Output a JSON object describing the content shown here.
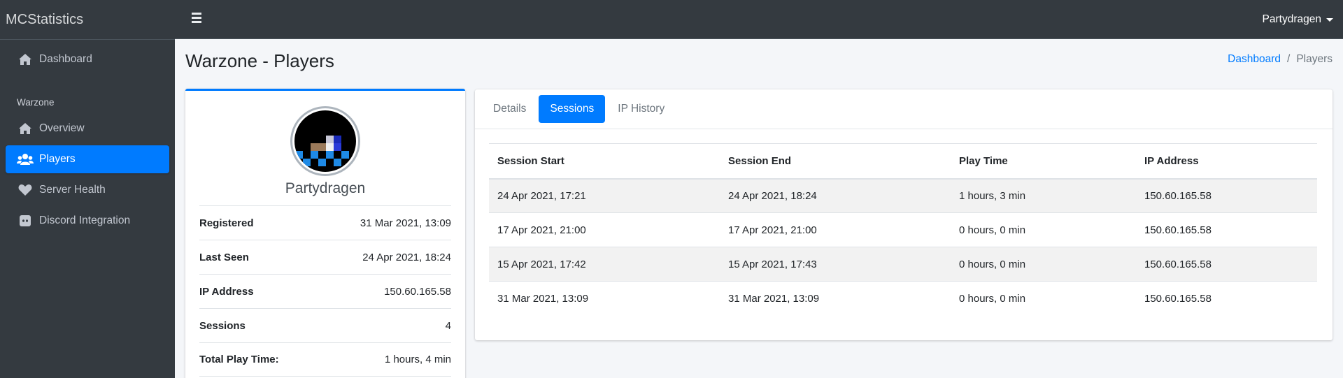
{
  "brand": "MCStatistics",
  "sidebar": {
    "items": [
      {
        "label": "Dashboard",
        "icon": "home-icon"
      },
      {
        "label": "Overview",
        "icon": "home-icon"
      },
      {
        "label": "Players",
        "icon": "users-icon",
        "active": true
      },
      {
        "label": "Server Health",
        "icon": "heart-icon"
      },
      {
        "label": "Discord Integration",
        "icon": "discord-icon"
      }
    ],
    "section_header": "Warzone"
  },
  "topbar": {
    "user": "Partydragen"
  },
  "page": {
    "title": "Warzone - Players"
  },
  "breadcrumb": {
    "home": "Dashboard",
    "separator": "/",
    "current": "Players"
  },
  "profile": {
    "name": "Partydragen",
    "rows": [
      {
        "label": "Registered",
        "value": "31 Mar 2021, 13:09"
      },
      {
        "label": "Last Seen",
        "value": "24 Apr 2021, 18:24"
      },
      {
        "label": "IP Address",
        "value": "150.60.165.58"
      },
      {
        "label": "Sessions",
        "value": "4"
      },
      {
        "label": "Total Play Time:",
        "value": "1 hours, 4 min"
      }
    ]
  },
  "tabs": [
    "Details",
    "Sessions",
    "IP History"
  ],
  "sessions": {
    "headers": [
      "Session Start",
      "Session End",
      "Play Time",
      "IP Address"
    ],
    "rows": [
      [
        "24 Apr 2021, 17:21",
        "24 Apr 2021, 18:24",
        "1 hours, 3 min",
        "150.60.165.58"
      ],
      [
        "17 Apr 2021, 21:00",
        "17 Apr 2021, 21:00",
        "0 hours, 0 min",
        "150.60.165.58"
      ],
      [
        "15 Apr 2021, 17:42",
        "15 Apr 2021, 17:43",
        "0 hours, 0 min",
        "150.60.165.58"
      ],
      [
        "31 Mar 2021, 13:09",
        "31 Mar 2021, 13:09",
        "0 hours, 0 min",
        "150.60.165.58"
      ]
    ]
  },
  "colors": {
    "accent": "#007bff",
    "sidebar_bg": "#343a40"
  }
}
